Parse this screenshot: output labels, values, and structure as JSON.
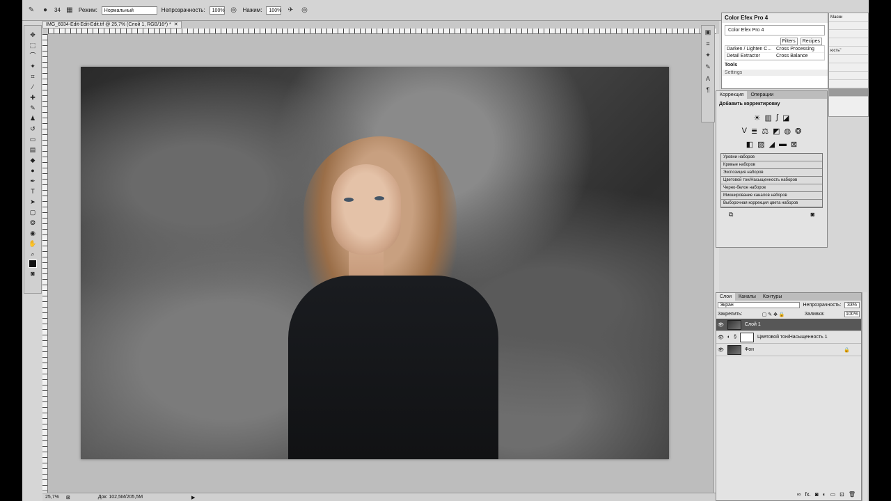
{
  "options_bar": {
    "brush_size": "34",
    "mode_label": "Режим:",
    "mode_value": "Нормальный",
    "opacity_label": "Непрозрачность:",
    "opacity_value": "100%",
    "flow_label": "Нажим:",
    "flow_value": "100%"
  },
  "document": {
    "tab_title": "IMG_6934-Edit-Edit-Edit.tif @ 25,7% (Слой 1, RGB/16*) *",
    "zoom": "25,7%",
    "doc_size": "Док: 102,5М/205,5М"
  },
  "color_efex": {
    "title": "Color Efex Pro 4",
    "dropdown": "Color Efex Pro 4",
    "tab_filters": "Filters",
    "tab_recipes": "Recipes",
    "filters": [
      "Darken / Lighten C...",
      "Cross Processing",
      "Detail Extractor",
      "Cross Balance"
    ],
    "tools_label": "Tools",
    "settings_label": "Settings"
  },
  "right_strip": {
    "items": [
      "Маски",
      "",
      "",
      "юсть\"",
      "",
      "",
      "",
      ""
    ]
  },
  "adjustments": {
    "tab_active": "Коррекция",
    "tab_other": "Операции",
    "title": "Добавить корректировку",
    "presets": [
      "Уровни наборов",
      "Кривые наборов",
      "Экспозиция наборов",
      "Цветовой тон/Насыщенность наборов",
      "Черно-белое наборов",
      "Микширование каналов наборов",
      "Выборочная коррекция цвета наборов"
    ]
  },
  "layers": {
    "tabs": [
      "Слои",
      "Каналы",
      "Контуры"
    ],
    "blend_mode": "Экран",
    "opacity_label": "Непрозрачность:",
    "opacity_value": "33%",
    "lock_label": "Закрепить:",
    "fill_label": "Заливка:",
    "fill_value": "100%",
    "items": [
      {
        "name": "Слой 1"
      },
      {
        "name": "Цветовой тон/Насыщенность 1"
      },
      {
        "name": "Фон"
      }
    ]
  }
}
